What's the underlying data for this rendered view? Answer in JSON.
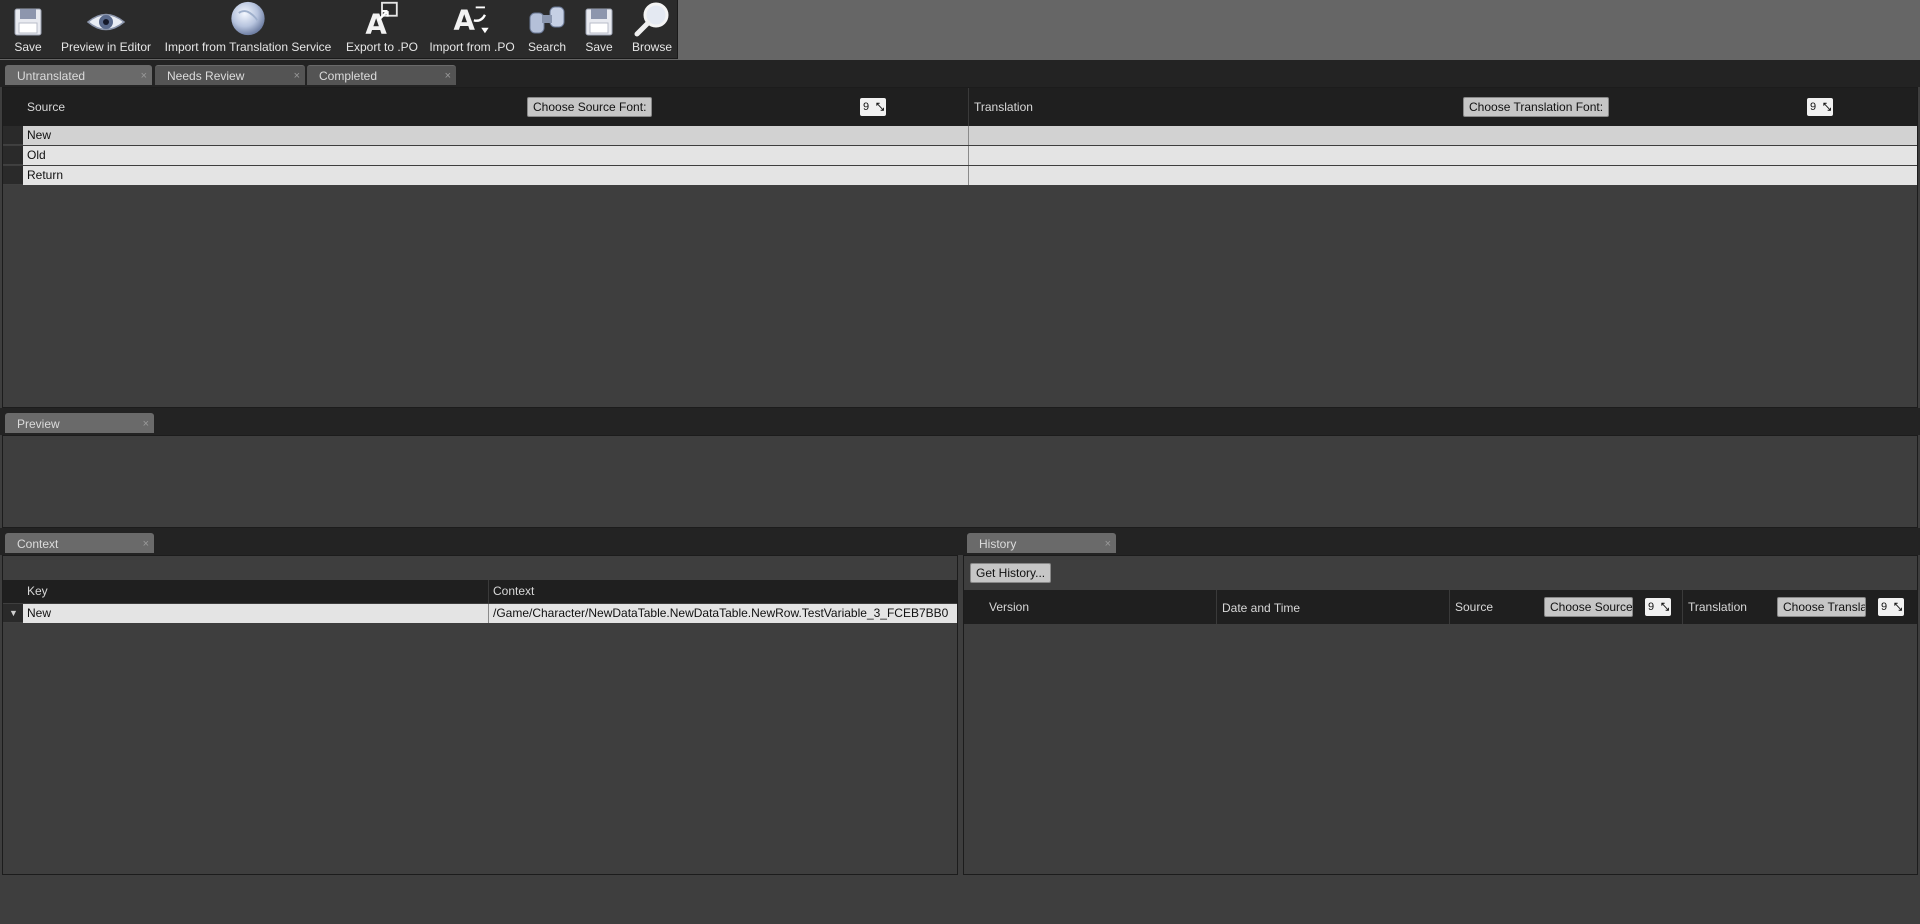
{
  "toolbar": {
    "buttons": [
      {
        "label": "Save",
        "icon": "floppy-disk-icon"
      },
      {
        "label": "Preview in Editor",
        "icon": "eye-icon"
      },
      {
        "label": "Import from Translation Service",
        "icon": "globe-icon"
      },
      {
        "label": "Export to .PO",
        "icon": "export-po-icon"
      },
      {
        "label": "Import from .PO",
        "icon": "import-po-icon"
      },
      {
        "label": "Search",
        "icon": "binoculars-icon"
      },
      {
        "label": "Save",
        "icon": "floppy-disk-icon"
      },
      {
        "label": "Browse",
        "icon": "magnifier-icon"
      }
    ]
  },
  "main_tabs": [
    {
      "label": "Untranslated",
      "close": "×",
      "active": true
    },
    {
      "label": "Needs Review",
      "close": "×",
      "active": false
    },
    {
      "label": "Completed",
      "close": "×",
      "active": false
    }
  ],
  "translation_table": {
    "source_header": "Source",
    "source_font_button": "Choose Source Font:",
    "source_font_size": "9",
    "translation_header": "Translation",
    "translation_font_button": "Choose Translation Font:",
    "translation_font_size": "9",
    "rows": [
      {
        "source": "New",
        "translation": ""
      },
      {
        "source": "Old",
        "translation": ""
      },
      {
        "source": "Return",
        "translation": ""
      }
    ]
  },
  "preview_tab": {
    "label": "Preview",
    "close": "×"
  },
  "context_tab": {
    "label": "Context",
    "close": "×"
  },
  "context_table": {
    "key_header": "Key",
    "context_header": "Context",
    "rows": [
      {
        "key": "New",
        "context": "/Game/Character/NewDataTable.NewDataTable.NewRow.TestVariable_3_FCEB7BB0"
      }
    ]
  },
  "history_tab": {
    "label": "History",
    "close": "×"
  },
  "history": {
    "get_history_button": "Get History...",
    "version_header": "Version",
    "date_header": "Date and Time",
    "source_header": "Source",
    "source_font_button": "Choose Source Font:",
    "source_font_size": "9",
    "translation_header": "Translation",
    "translation_font_button": "Choose Translation Font:",
    "translation_font_size": "9"
  },
  "colors": {
    "background": "#3e3e3e",
    "toolbar": "#2b2b2b",
    "row_light": "#e4e4e4",
    "row_selected": "#d2d2d2"
  }
}
